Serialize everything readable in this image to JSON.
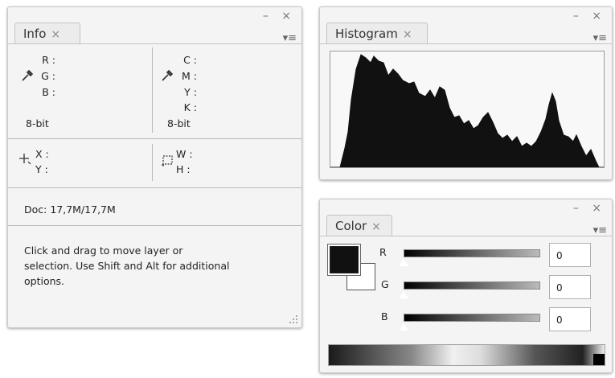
{
  "info": {
    "tab": "Info",
    "close": "×",
    "win_buttons": "– ×",
    "menu": "▾≡",
    "rgb_labels": {
      "r": "R :",
      "g": "G :",
      "b": "B :"
    },
    "rgb_bit": "8-bit",
    "cmyk_labels": {
      "c": "C :",
      "m": "M :",
      "y": "Y :",
      "k": "K :"
    },
    "cmyk_bit": "8-bit",
    "xy_labels": {
      "x": "X :",
      "y": "Y :"
    },
    "wh_labels": {
      "w": "W :",
      "h": "H :"
    },
    "doc": "Doc: 17,7M/17,7M",
    "hint_line1": "Click and drag to move layer or",
    "hint_line2": "selection.  Use Shift and Alt for additional",
    "hint_line3": "options."
  },
  "histogram": {
    "tab": "Histogram",
    "close": "×",
    "win_buttons": "– ×",
    "menu": "▾≡"
  },
  "color": {
    "tab": "Color",
    "close": "×",
    "win_buttons": "– ×",
    "menu": "▾≡",
    "foreground_color": "#111111",
    "background_color": "#ffffff",
    "channels": [
      {
        "label": "R",
        "value": "0"
      },
      {
        "label": "G",
        "value": "0"
      },
      {
        "label": "B",
        "value": "0"
      }
    ]
  }
}
